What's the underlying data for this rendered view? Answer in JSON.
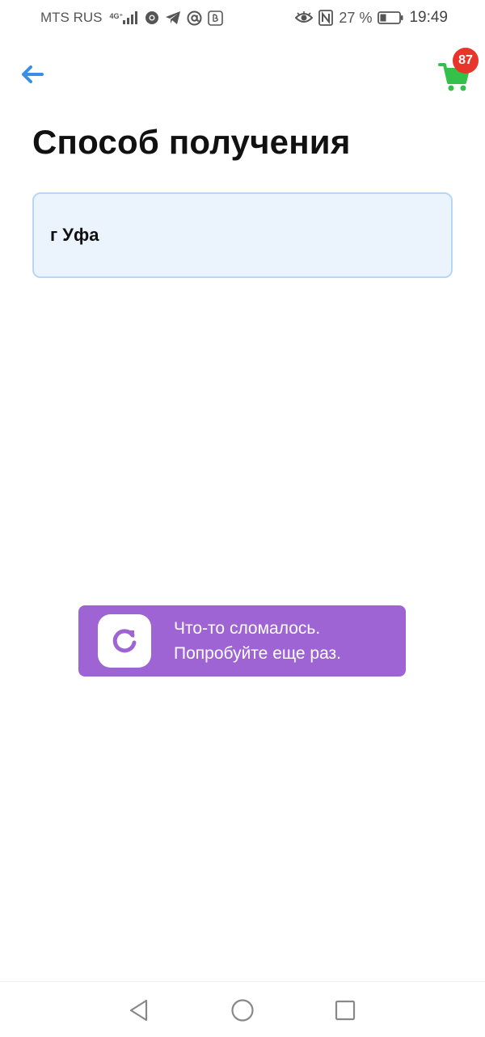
{
  "status_bar": {
    "carrier": "MTS RUS",
    "network_type": "4G⁺",
    "battery_percent": "27 %",
    "time": "19:49",
    "icons": [
      "signal-icon",
      "chrome-icon",
      "telegram-icon",
      "at-sign-icon",
      "mail-app-icon",
      "eye-icon",
      "nfc-icon",
      "battery-icon"
    ]
  },
  "header": {
    "back_icon": "arrow-left-icon",
    "cart_icon": "shopping-cart-icon",
    "cart_count": "87"
  },
  "page": {
    "title": "Способ получения",
    "city_value": "г Уфа"
  },
  "error_toast": {
    "icon": "refresh-icon",
    "line1": "Что-то сломалось.",
    "line2": "Попробуйте еще раз."
  },
  "nav_bar": {
    "buttons": [
      "back-triangle-icon",
      "home-circle-icon",
      "recents-square-icon"
    ]
  },
  "colors": {
    "accent_blue": "#3a8ee6",
    "cart_green": "#33c14a",
    "badge_red": "#e8352c",
    "toast_purple": "#9f64d4",
    "field_bg": "#ebf3fd",
    "field_border": "#b8d6f5"
  }
}
